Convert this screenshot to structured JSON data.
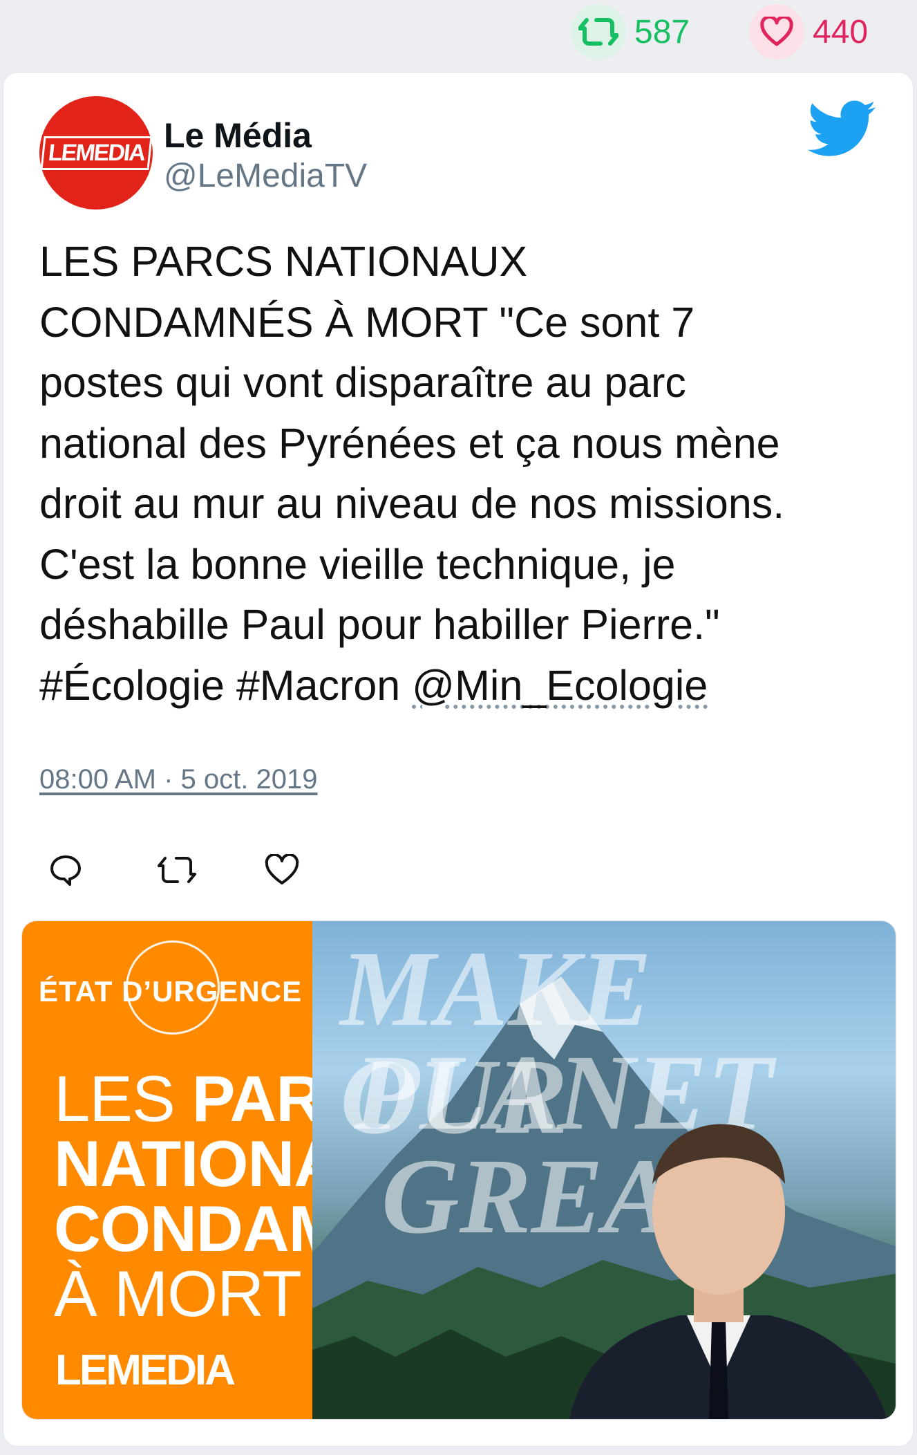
{
  "stats": {
    "retweets": "587",
    "likes": "440"
  },
  "author": {
    "name": "Le Média",
    "handle": "@LeMediaTV",
    "avatar_text": "LEMEDIA"
  },
  "tweet": {
    "lines": [
      "LES PARCS NATIONAUX",
      "CONDAMNÉS À MORT \"Ce sont 7",
      "postes qui vont disparaître au parc",
      "national des Pyrénées et ça nous mène",
      "droit au mur au niveau de nos missions.",
      "C'est la bonne vieille technique, je",
      "déshabille Paul pour habiller Pierre.\""
    ],
    "hashtags": "#Écologie #Macron",
    "mention": "@Min_Ecologie",
    "timestamp": "08:00 AM · 5 oct. 2019"
  },
  "media": {
    "kicker": "ÉTAT D’URGENCE",
    "headline_l1_light": "LES ",
    "headline_l1_bold": "PARCS",
    "headline_l2": "NATIONAUX",
    "headline_l3": "CONDAMNÉS",
    "headline_l4": "À MORT",
    "brand": "LEMEDIA",
    "bg_words": [
      "MAKE OUR",
      "PLANET",
      "GREAT"
    ]
  },
  "colors": {
    "retweet_green": "#17bf63",
    "like_red": "#e0245e",
    "twitter_blue": "#1da1f2",
    "brand_red": "#e2231a",
    "orange": "#ff8a00"
  },
  "icons": [
    "retweet-icon",
    "heart-icon",
    "twitter-bird-icon",
    "reply-icon"
  ]
}
